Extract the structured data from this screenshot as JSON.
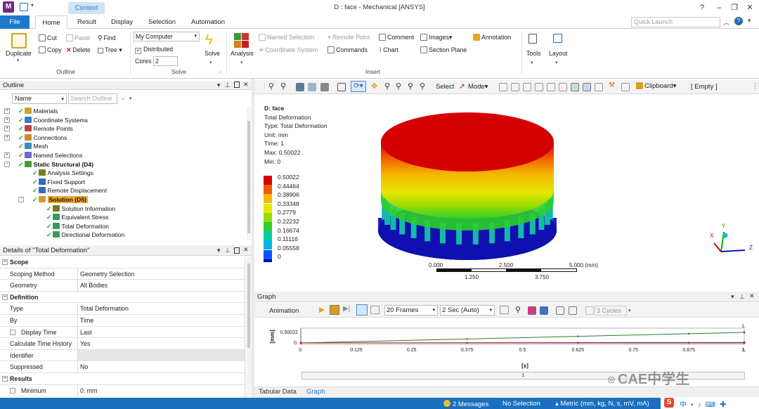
{
  "window": {
    "title": "D : face - Mechanical [ANSYS]",
    "context_tab": "Context",
    "logo": "M"
  },
  "tabs": [
    "File",
    "Home",
    "Result",
    "Display",
    "Selection",
    "Automation"
  ],
  "quick_launch": {
    "placeholder": "Quick Launch"
  },
  "ribbon": {
    "outline_group": {
      "label": "Outline",
      "duplicate": "Duplicate",
      "cut": "Cut",
      "copy": "Copy",
      "paste": "Paste",
      "delete": "Delete",
      "find": "Find",
      "tree": "Tree"
    },
    "solve_group": {
      "label": "Solve",
      "target": "My Computer",
      "distributed": "Distributed",
      "cores_label": "Cores",
      "cores_value": "2",
      "solve": "Solve"
    },
    "analysis": "Analysis",
    "insert_group": {
      "label": "Insert",
      "named_selection": "Named Selection",
      "coordinate_system": "Coordinate System",
      "remote_point": "Remote Point",
      "commands": "Commands",
      "comment": "Comment",
      "chart": "Chart",
      "images": "Images",
      "section_plane": "Section Plane",
      "annotation": "Annotation"
    },
    "tools": "Tools",
    "layout": "Layout"
  },
  "outline": {
    "title": "Outline",
    "filter": "Name",
    "search_placeholder": "Search Outline",
    "items": [
      {
        "label": "Materials",
        "depth": 1,
        "expand": "+",
        "icon_color": "#c9a227"
      },
      {
        "label": "Coordinate Systems",
        "depth": 1,
        "expand": "+",
        "icon_color": "#3a7ac8"
      },
      {
        "label": "Remote Points",
        "depth": 1,
        "expand": "+",
        "icon_color": "#c04040"
      },
      {
        "label": "Connections",
        "depth": 1,
        "expand": "+",
        "icon_color": "#d08a2a"
      },
      {
        "label": "Mesh",
        "depth": 1,
        "expand": "",
        "icon_color": "#3a8fc0"
      },
      {
        "label": "Named Selections",
        "depth": 1,
        "expand": "+",
        "icon_color": "#6a6ad0"
      },
      {
        "label": "Static Structural (D4)",
        "depth": 1,
        "expand": "-",
        "icon_color": "#4a9a3a",
        "bold": true
      },
      {
        "label": "Analysis Settings",
        "depth": 2,
        "expand": "",
        "icon_color": "#7a7a20"
      },
      {
        "label": "Fixed Support",
        "depth": 2,
        "expand": "",
        "icon_color": "#3a6ac0"
      },
      {
        "label": "Remote Displacement",
        "depth": 2,
        "expand": "",
        "icon_color": "#3a6ac0"
      },
      {
        "label": "Solution (D5)",
        "depth": 2,
        "expand": "-",
        "icon_color": "#d09a2a",
        "bold": true,
        "highlight": true
      },
      {
        "label": "Solution Information",
        "depth": 3,
        "expand": "",
        "icon_color": "#7a7a20"
      },
      {
        "label": "Equivalent Stress",
        "depth": 3,
        "expand": "",
        "icon_color": "#3a9a5a"
      },
      {
        "label": "Total Deformation",
        "depth": 3,
        "expand": "",
        "icon_color": "#3a9a5a"
      },
      {
        "label": "Directional Deformation",
        "depth": 3,
        "expand": "",
        "icon_color": "#3a9a5a"
      }
    ]
  },
  "details": {
    "title": "Details of \"Total Deformation\"",
    "sections": [
      {
        "name": "Scope",
        "rows": [
          {
            "k": "Scoping Method",
            "v": "Geometry Selection"
          },
          {
            "k": "Geometry",
            "v": "All Bodies"
          }
        ]
      },
      {
        "name": "Definition",
        "rows": [
          {
            "k": "Type",
            "v": "Total Deformation"
          },
          {
            "k": "By",
            "v": "Time"
          },
          {
            "k": "Display Time",
            "v": "Last",
            "check": true
          },
          {
            "k": "Calculate Time History",
            "v": "Yes"
          },
          {
            "k": "Identifier",
            "v": "",
            "grey": true
          },
          {
            "k": "Suppressed",
            "v": "No"
          }
        ]
      },
      {
        "name": "Results",
        "rows": [
          {
            "k": "Minimum",
            "v": "0. mm",
            "check": true
          }
        ]
      }
    ]
  },
  "viewport": {
    "toolbar": {
      "select": "Select",
      "mode": "Mode",
      "clipboard": "Clipboard",
      "clipboard_state": "[ Empty ]"
    },
    "header": [
      "D: face",
      "Total Deformation",
      "Type: Total Deformation",
      "Unit: mm",
      "Time: 1",
      "Max: 0.50022",
      "Min: 0"
    ],
    "legend": [
      {
        "value": "0.50022",
        "color": "#d40000"
      },
      {
        "value": "0.44464",
        "color": "#f25a00"
      },
      {
        "value": "0.38906",
        "color": "#f5b800"
      },
      {
        "value": "0.33348",
        "color": "#e6e600"
      },
      {
        "value": "0.2779",
        "color": "#9bdc00"
      },
      {
        "value": "0.22232",
        "color": "#2ccf2c"
      },
      {
        "value": "0.16674",
        "color": "#00cfa0"
      },
      {
        "value": "0.11116",
        "color": "#00b4e6"
      },
      {
        "value": "0.05558",
        "color": "#0055ff"
      },
      {
        "value": "0",
        "color": "#0000c8"
      }
    ],
    "scale": {
      "top": [
        "0.000",
        "2.500",
        "5.000 (mm)"
      ],
      "bottom": [
        "1.250",
        "3.750"
      ]
    },
    "triad": {
      "x": "X",
      "y": "Y",
      "z": "Z"
    }
  },
  "graph": {
    "title": "Graph",
    "animation": "Animation",
    "frames": "20 Frames",
    "duration": "2 Sec (Auto)",
    "cycles": "3 Cycles",
    "chart_data": {
      "type": "line",
      "ylabel": "[mm]",
      "xlabel": "[s]",
      "yticks": [
        "0.50022",
        "0."
      ],
      "xticks": [
        "0.",
        "0.125",
        "0.25",
        "0.375",
        "0.5",
        "0.625",
        "0.75",
        "0.875",
        "1."
      ],
      "right_labels": [
        "1.",
        "1."
      ],
      "xlim": [
        0,
        1
      ],
      "ylim": [
        0,
        0.50022
      ],
      "series": [
        {
          "x": [
            0,
            1
          ],
          "y": [
            0,
            0.50022
          ],
          "color": "#2a7a2a"
        },
        {
          "x": [
            0,
            1
          ],
          "y": [
            0,
            0.02
          ],
          "color": "#3030b0"
        },
        {
          "x": [
            0,
            1
          ],
          "y": [
            0,
            0
          ],
          "color": "#b02020"
        }
      ],
      "scrollbar_label": "1"
    },
    "tabs": [
      "Tabular Data",
      "Graph"
    ]
  },
  "status": {
    "messages": "2 Messages",
    "selection": "No Selection",
    "units": "Metric (mm, kg, N, s, mV, mA)"
  },
  "watermark": "CAE中学生"
}
